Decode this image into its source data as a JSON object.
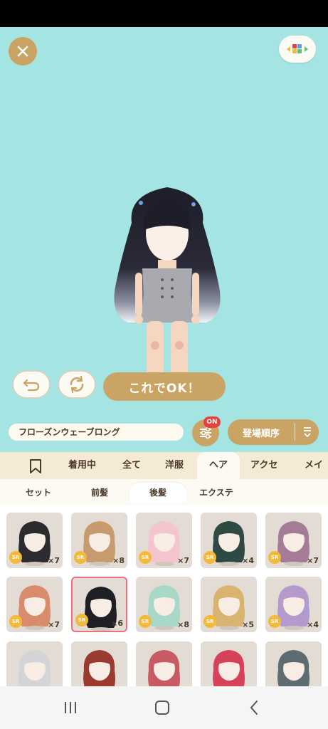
{
  "stage": {
    "ok_button": "これでOK！"
  },
  "controls": {
    "item_name": "フローズンウェーブロング",
    "filter_badge": "ON",
    "sort_label": "登場順序"
  },
  "tabs": [
    "着用中",
    "全て",
    "洋服",
    "ヘア",
    "アクセ",
    "メイク"
  ],
  "active_tab": "ヘア",
  "subtabs": [
    "セット",
    "前髪",
    "後髪",
    "エクステ"
  ],
  "active_subtab": "後髪",
  "items": [
    {
      "rarity": "SR",
      "count": "×7",
      "hair": "#2c2c30",
      "skin": "#f7ede4"
    },
    {
      "rarity": "SR",
      "count": "×8",
      "hair": "#c79b6e",
      "skin": "#f7ede4"
    },
    {
      "rarity": "SR",
      "count": "×7",
      "hair": "#f4c4cf",
      "skin": "#f7ede4"
    },
    {
      "rarity": "SR",
      "count": "×4",
      "hair": "#2f4a45",
      "skin": "#f7ede4"
    },
    {
      "rarity": "SR",
      "count": "×7",
      "hair": "#a57c98",
      "skin": "#f7ede4"
    },
    {
      "rarity": "SR",
      "count": "×7",
      "hair": "#d98c6c",
      "skin": "#f7ede4"
    },
    {
      "rarity": "SR",
      "count": "×6",
      "hair": "#1f1f26",
      "skin": "#f7ede4"
    },
    {
      "rarity": "SR",
      "count": "×8",
      "hair": "#a8d8c8",
      "skin": "#f7ede4"
    },
    {
      "rarity": "SR",
      "count": "×5",
      "hair": "#d9b370",
      "skin": "#f7ede4"
    },
    {
      "rarity": "SR",
      "count": "×4",
      "hair": "#b59acd",
      "skin": "#f7ede4"
    },
    {
      "rarity": "",
      "count": "",
      "hair": "#d4d4d8",
      "skin": "#f7ede4"
    },
    {
      "rarity": "",
      "count": "",
      "hair": "#9b3a2e",
      "skin": "#f7ede4"
    },
    {
      "rarity": "",
      "count": "",
      "hair": "#c85a63",
      "skin": "#f7ede4"
    },
    {
      "rarity": "",
      "count": "",
      "hair": "#d6425a",
      "skin": "#f7ede4"
    },
    {
      "rarity": "",
      "count": "",
      "hair": "#5e6b70",
      "skin": "#f7ede4"
    }
  ],
  "colors": {
    "stage_bg": "#a4e4e2",
    "accent_gold": "#c9a464",
    "badge_red": "#e8413b",
    "sr_yellow": "#f3b93a",
    "selected_border": "#e7737f"
  }
}
